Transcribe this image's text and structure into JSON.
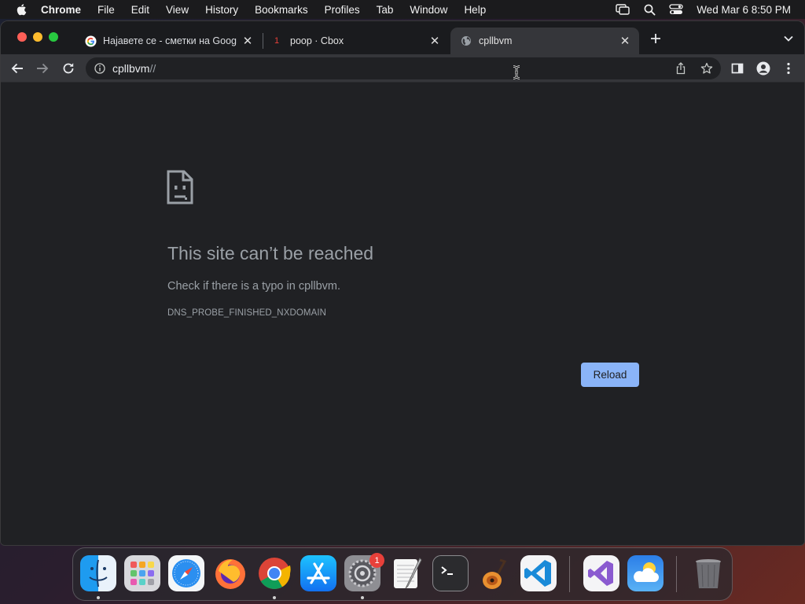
{
  "menubar": {
    "app": "Chrome",
    "items": [
      "File",
      "Edit",
      "View",
      "History",
      "Bookmarks",
      "Profiles",
      "Tab",
      "Window",
      "Help"
    ],
    "clock": "Wed Mar 6  8:50 PM"
  },
  "tabs": [
    {
      "title": "Најавете се - сметки на Google",
      "favicon": "google-icon",
      "active": false
    },
    {
      "title": "poop · Cbox",
      "badge": "1",
      "favicon": "cbox-icon",
      "active": false
    },
    {
      "title": "cpllbvm",
      "favicon": "globe-icon",
      "active": true
    }
  ],
  "omnibox": {
    "url_host": "cpllbvm",
    "url_rest": "//"
  },
  "error_page": {
    "heading": "This site can’t be reached",
    "message": "Check if there is a typo in cpllbvm.",
    "error_code": "DNS_PROBE_FINISHED_NXDOMAIN",
    "reload_label": "Reload"
  },
  "dock": {
    "apps": [
      "finder",
      "launchpad",
      "safari",
      "firefox",
      "chrome",
      "app-store",
      "system-settings",
      "textedit",
      "terminal",
      "garageband",
      "vscode",
      "visual-studio",
      "weather",
      "trash"
    ],
    "settings_badge": "1"
  },
  "colors": {
    "accent": "#8ab4f8",
    "page_bg": "#202124",
    "toolbar_bg": "#35363a",
    "muted_text": "#9aa0a6"
  }
}
